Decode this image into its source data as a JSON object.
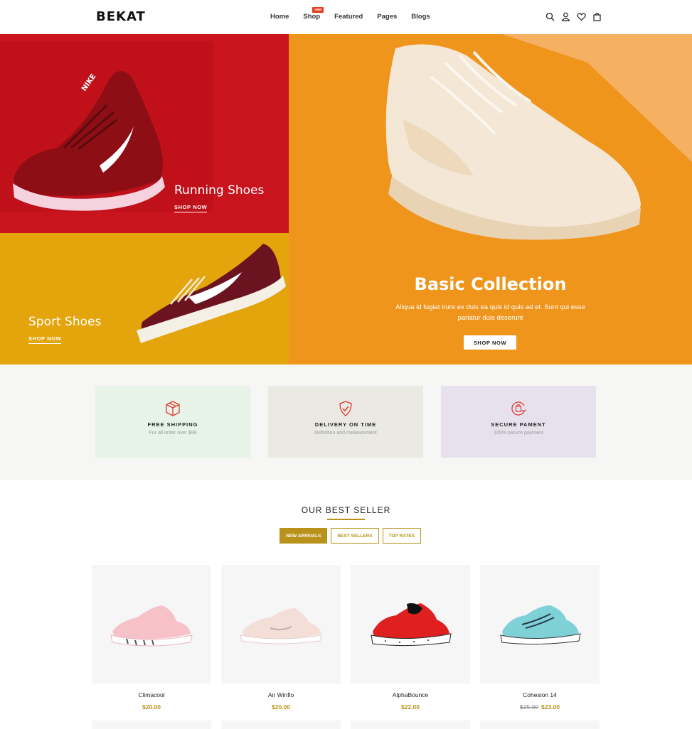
{
  "brand": "BEKAT",
  "nav": {
    "items": [
      "Home",
      "Shop",
      "Featured",
      "Pages",
      "Blogs"
    ],
    "shop_badge": "new"
  },
  "header_icons": [
    "search-icon",
    "user-icon",
    "heart-icon",
    "bag-icon"
  ],
  "hero": {
    "running": {
      "title": "Running Shoes",
      "link": "SHOP NOW"
    },
    "sport": {
      "title": "Sport Shoes",
      "link": "SHOP NOW"
    },
    "basic": {
      "title": "Basic Collection",
      "desc": "Aliqua id fugiat irure ex duis ea quis id quis ad et. Sunt qui esse pariatur duis deserunt",
      "button": "SHOP NOW"
    }
  },
  "features": [
    {
      "title": "FREE SHIPPING",
      "sub": "For all order over $99",
      "icon": "box-icon",
      "bg": "#e6f3e6"
    },
    {
      "title": "DELIVERY ON TIME",
      "sub": "Definition and measurement",
      "icon": "shield-check-icon",
      "bg": "#eaeae3"
    },
    {
      "title": "SECURE PAMENT",
      "sub": "100% secure payment",
      "icon": "secure-payment-icon",
      "bg": "#e6e1ec"
    }
  ],
  "best_seller": {
    "title": "OUR BEST SELLER",
    "tabs": [
      "NEW ARRIVALS",
      "BEST SELLERS",
      "TOP RATES"
    ],
    "products": [
      {
        "name": "Climacool",
        "price": "$20.00",
        "old_price": ""
      },
      {
        "name": "Air Winflo",
        "price": "$20.00",
        "old_price": ""
      },
      {
        "name": "AlphaBounce",
        "price": "$22.00",
        "old_price": ""
      },
      {
        "name": "Cohesion 14",
        "price": "$23.00",
        "old_price": "$25.00"
      }
    ]
  },
  "colors": {
    "accent": "#b9921c",
    "red_panel": "#c9141e",
    "yellow_panel": "#e3a50b",
    "orange_panel": "#f0951c",
    "icon_red": "#e03a32"
  }
}
